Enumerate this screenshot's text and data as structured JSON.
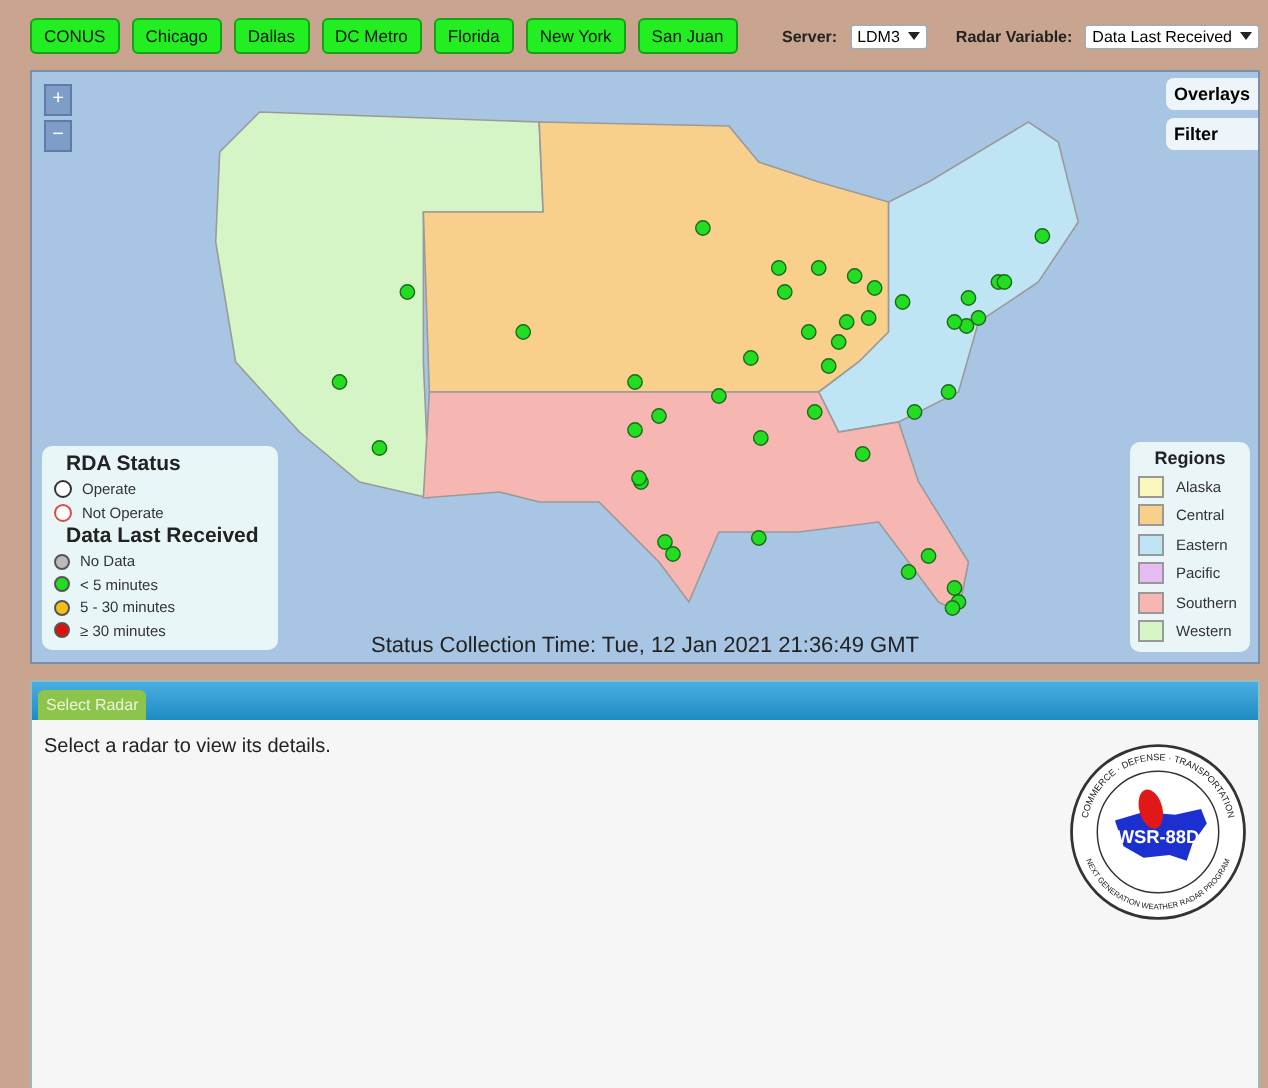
{
  "region_buttons": [
    {
      "label": "CONUS"
    },
    {
      "label": "Chicago"
    },
    {
      "label": "Dallas"
    },
    {
      "label": "DC Metro"
    },
    {
      "label": "Florida"
    },
    {
      "label": "New York"
    },
    {
      "label": "San Juan"
    }
  ],
  "server": {
    "label": "Server:",
    "value": "LDM3"
  },
  "radar_variable": {
    "label": "Radar Variable:",
    "value": "Data Last Received"
  },
  "map": {
    "zoom_in": "+",
    "zoom_out": "−",
    "overlays": "Overlays",
    "filter": "Filter",
    "status_time": "Status Collection Time: Tue, 12 Jan 2021 21:36:49 GMT"
  },
  "rda_legend": {
    "title": "RDA Status",
    "items": [
      {
        "label": "Operate",
        "color": "#333333"
      },
      {
        "label": "Not Operate",
        "color": "#e04848"
      }
    ]
  },
  "data_legend": {
    "title": "Data Last Received",
    "items": [
      {
        "label": "No Data",
        "color": "#bbbbbb"
      },
      {
        "label": "< 5 minutes",
        "color": "#22dd22"
      },
      {
        "label": "5 - 30 minutes",
        "color": "#f6bd16"
      },
      {
        "label": "≥ 30 minutes",
        "color": "#e01010"
      }
    ]
  },
  "regions_legend": {
    "title": "Regions",
    "items": [
      {
        "label": "Alaska",
        "color": "#fbf7bf"
      },
      {
        "label": "Central",
        "color": "#f8d08c"
      },
      {
        "label": "Eastern",
        "color": "#bfe5f4"
      },
      {
        "label": "Pacific",
        "color": "#e6bdf2"
      },
      {
        "label": "Southern",
        "color": "#f6b6b2"
      },
      {
        "label": "Western",
        "color": "#d6f5c6"
      }
    ]
  },
  "panel": {
    "tab": "Select Radar",
    "message": "Select a radar to view its details.",
    "logo": {
      "center": "WSR-88D",
      "top_ring": "COMMERCE · DEFENSE · TRANSPORTATION",
      "bottom_ring": "NEXT GENERATION WEATHER RADAR PROGRAM"
    }
  }
}
